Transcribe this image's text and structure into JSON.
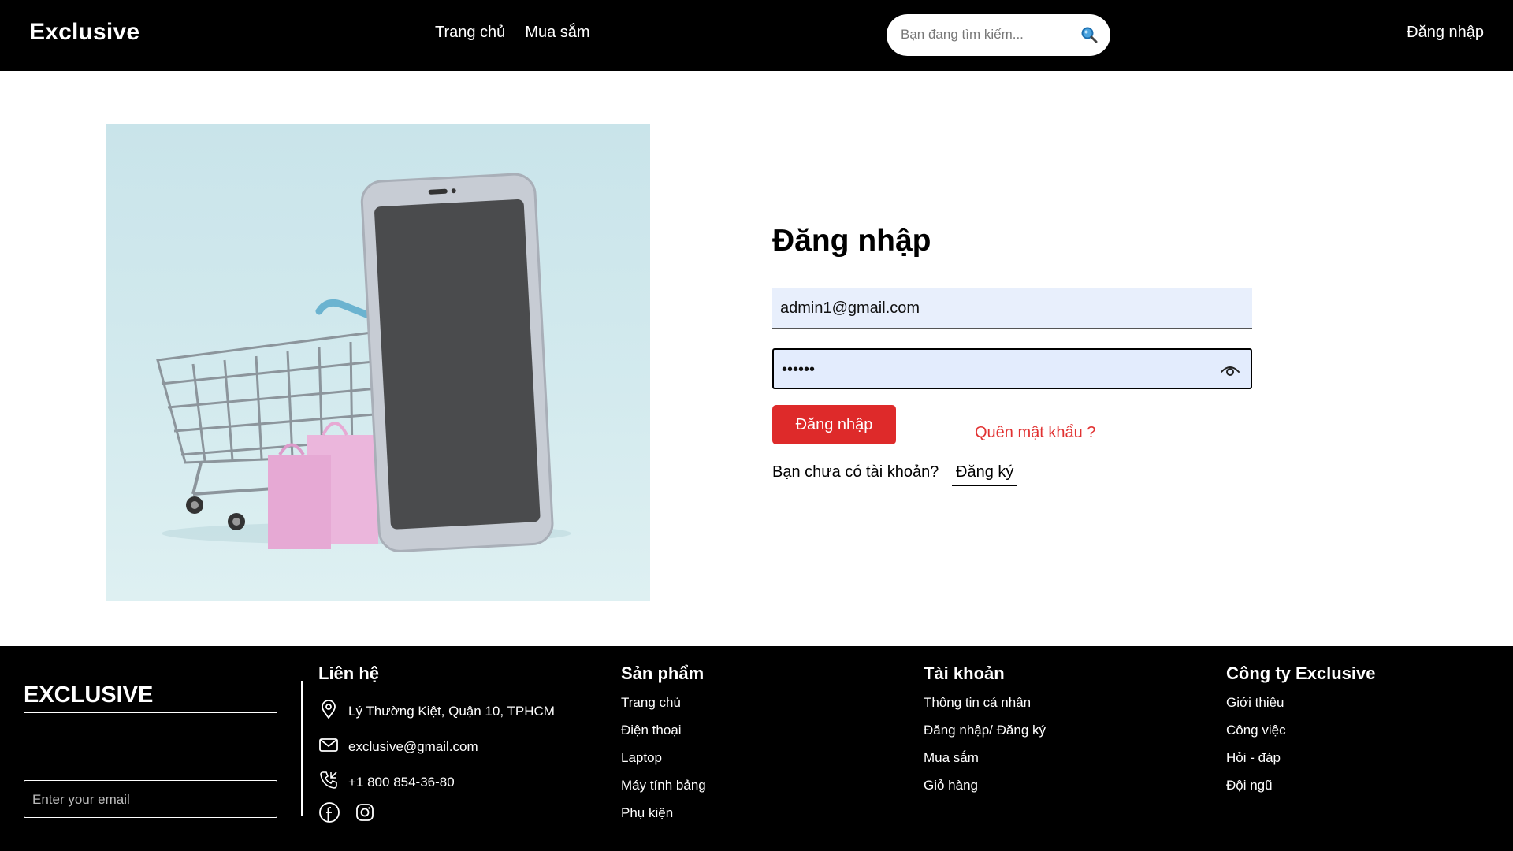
{
  "header": {
    "logo": "Exclusive",
    "nav": [
      "Trang chủ",
      "Mua sắm"
    ],
    "search_placeholder": "Bạn đang tìm kiếm...",
    "login_link": "Đăng nhập"
  },
  "login": {
    "title": "Đăng nhập",
    "email_value": "admin1@gmail.com",
    "password_value": "••••••",
    "submit_label": "Đăng nhập",
    "forgot_label": "Quên mật khẩu ?",
    "signup_question": "Bạn chưa có tài khoản?",
    "signup_link": "Đăng ký"
  },
  "footer": {
    "brand": "EXCLUSIVE",
    "email_placeholder": "Enter your email",
    "contact": {
      "title": "Liên hệ",
      "address": "Lý Thường Kiệt, Quận 10, TPHCM",
      "email": "exclusive@gmail.com",
      "phone": "+1 800 854-36-80"
    },
    "products": {
      "title": "Sản phẩm",
      "items": [
        "Trang chủ",
        "Điện thoại",
        "Laptop",
        "Máy tính bảng",
        "Phụ kiện"
      ]
    },
    "account": {
      "title": "Tài khoản",
      "items": [
        "Thông tin cá nhân",
        "Đăng nhập/ Đăng ký",
        "Mua sắm",
        "Giỏ hàng"
      ]
    },
    "company": {
      "title": "Công ty Exclusive",
      "items": [
        "Giới thiệu",
        "Công việc",
        "Hỏi - đáp",
        "Đội ngũ"
      ]
    }
  },
  "colors": {
    "accent": "#de2a2a",
    "header_bg": "#000000",
    "hero_bg": "#cfe7ec"
  },
  "icons": [
    "search-icon",
    "eye-icon",
    "location-icon",
    "mail-icon",
    "phone-icon",
    "facebook-icon",
    "instagram-icon"
  ]
}
